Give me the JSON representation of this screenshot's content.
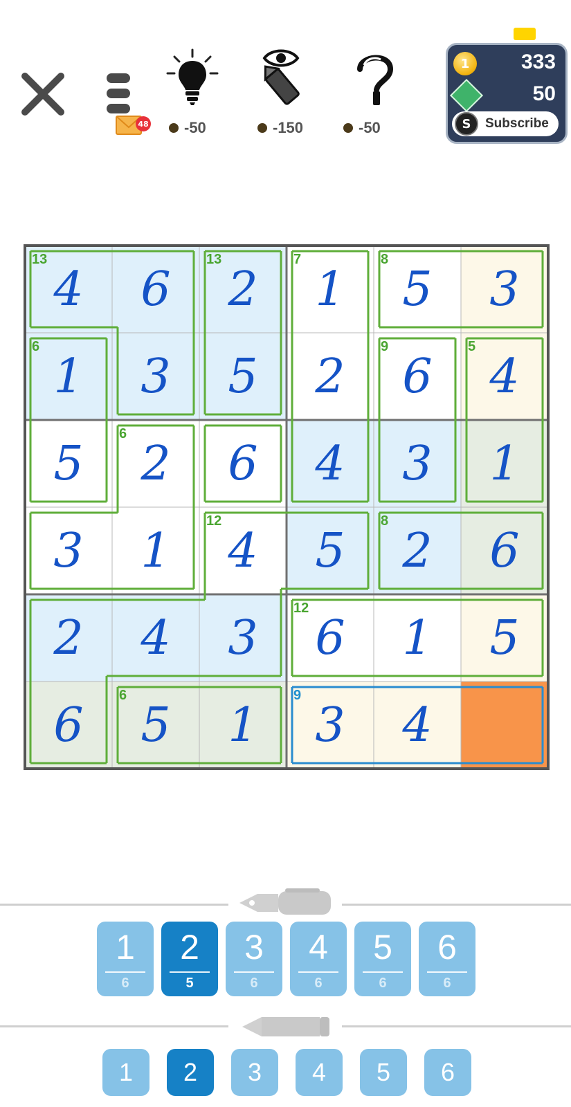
{
  "toolbar": {
    "mail_count": "48",
    "hint_cost": "-50",
    "reveal_cost": "-150",
    "check_cost": "-50",
    "coins": "333",
    "tokens": "50",
    "subscribe_label": "Subscribe",
    "coin_glyph": "1",
    "subscribe_glyph": "S",
    "token_label": "TOKEN"
  },
  "board": {
    "size": 6,
    "cells": [
      [
        "4",
        "6",
        "2",
        "1",
        "5",
        "3"
      ],
      [
        "1",
        "3",
        "5",
        "2",
        "6",
        "4"
      ],
      [
        "5",
        "2",
        "6",
        "4",
        "3",
        "1"
      ],
      [
        "3",
        "1",
        "4",
        "5",
        "2",
        "6"
      ],
      [
        "2",
        "4",
        "3",
        "6",
        "1",
        "5"
      ],
      [
        "6",
        "5",
        "1",
        "3",
        "4",
        ""
      ]
    ],
    "colors": [
      [
        "#dff0fb",
        "#dff0fb",
        "#dff0fb",
        "#ffffff",
        "#ffffff",
        "#fdf8e8"
      ],
      [
        "#dff0fb",
        "#dff0fb",
        "#dff0fb",
        "#ffffff",
        "#ffffff",
        "#fdf8e8"
      ],
      [
        "#ffffff",
        "#ffffff",
        "#ffffff",
        "#dff0fb",
        "#dff0fb",
        "#e6ede2"
      ],
      [
        "#ffffff",
        "#ffffff",
        "#ffffff",
        "#dff0fb",
        "#dff0fb",
        "#e6ede2"
      ],
      [
        "#dff0fb",
        "#dff0fb",
        "#dff0fb",
        "#ffffff",
        "#ffffff",
        "#fdf8e8"
      ],
      [
        "#e6ede2",
        "#e6ede2",
        "#e6ede2",
        "#fdf8e8",
        "#fdf8e8",
        "#f8944a"
      ]
    ],
    "selected_cell": [
      5,
      5
    ],
    "cages": [
      {
        "sum": "13",
        "cells": [
          [
            0,
            0
          ],
          [
            0,
            1
          ],
          [
            1,
            1
          ]
        ],
        "active": false
      },
      {
        "sum": "13",
        "cells": [
          [
            0,
            2
          ],
          [
            1,
            2
          ]
        ],
        "active": false
      },
      {
        "sum": "7",
        "cells": [
          [
            0,
            3
          ],
          [
            1,
            3
          ],
          [
            2,
            3
          ]
        ],
        "active": false
      },
      {
        "sum": "8",
        "cells": [
          [
            0,
            4
          ],
          [
            0,
            5
          ]
        ],
        "active": false
      },
      {
        "sum": "6",
        "cells": [
          [
            1,
            0
          ],
          [
            2,
            0
          ]
        ],
        "active": false
      },
      {
        "sum": "9",
        "cells": [
          [
            1,
            4
          ],
          [
            2,
            4
          ]
        ],
        "active": false
      },
      {
        "sum": "5",
        "cells": [
          [
            1,
            5
          ],
          [
            2,
            5
          ]
        ],
        "active": false
      },
      {
        "sum": "6",
        "cells": [
          [
            2,
            1
          ],
          [
            3,
            1
          ],
          [
            3,
            0
          ]
        ],
        "active": false
      },
      {
        "sum": "",
        "cells": [
          [
            2,
            2
          ]
        ],
        "active": false
      },
      {
        "sum": "12",
        "cells": [
          [
            3,
            2
          ],
          [
            3,
            3
          ],
          [
            4,
            0
          ],
          [
            4,
            1
          ],
          [
            4,
            2
          ],
          [
            5,
            0
          ]
        ],
        "active": false
      },
      {
        "sum": "8",
        "cells": [
          [
            3,
            4
          ],
          [
            3,
            5
          ]
        ],
        "active": false
      },
      {
        "sum": "12",
        "cells": [
          [
            4,
            3
          ],
          [
            4,
            4
          ],
          [
            4,
            5
          ]
        ],
        "active": false
      },
      {
        "sum": "6",
        "cells": [
          [
            5,
            1
          ],
          [
            5,
            2
          ]
        ],
        "active": false
      },
      {
        "sum": "9",
        "cells": [
          [
            5,
            3
          ],
          [
            5,
            4
          ],
          [
            5,
            5
          ]
        ],
        "active": true
      }
    ]
  },
  "pen_pad": {
    "keys": [
      {
        "label": "1",
        "remaining": "6"
      },
      {
        "label": "2",
        "remaining": "5"
      },
      {
        "label": "3",
        "remaining": "6"
      },
      {
        "label": "4",
        "remaining": "6"
      },
      {
        "label": "5",
        "remaining": "6"
      },
      {
        "label": "6",
        "remaining": "6"
      }
    ],
    "selected_index": 1
  },
  "pencil_pad": {
    "keys": [
      "1",
      "2",
      "3",
      "4",
      "5",
      "6"
    ],
    "selected_index": 1
  },
  "colors": {
    "cage_line": "#5fae3a",
    "active_cage_line": "#2a8ccf",
    "digit": "#1553c6",
    "key_bg": "#86c2e7",
    "key_selected_bg": "#1681c6"
  }
}
